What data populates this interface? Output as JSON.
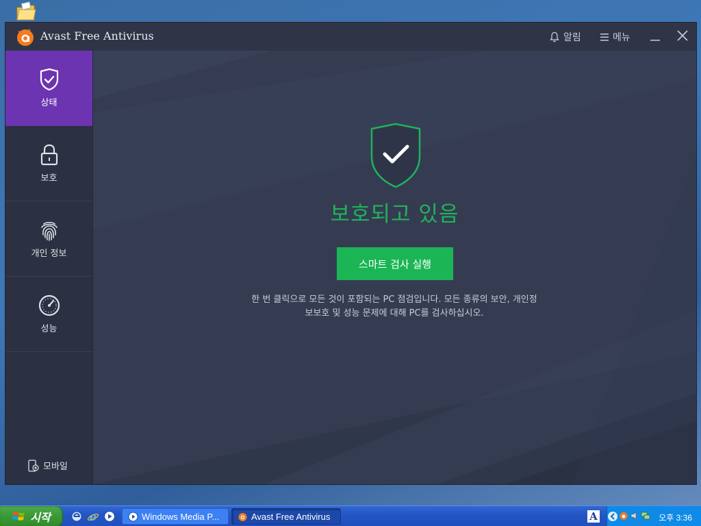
{
  "window": {
    "title": "Avast Free Antivirus",
    "alerts_label": "알림",
    "menu_label": "메뉴"
  },
  "sidebar": {
    "items": [
      {
        "label": "상태",
        "icon": "shield-check-icon",
        "active": true
      },
      {
        "label": "보호",
        "icon": "lock-icon",
        "active": false
      },
      {
        "label": "개인 정보",
        "icon": "fingerprint-icon",
        "active": false
      },
      {
        "label": "성능",
        "icon": "speedometer-icon",
        "active": false
      }
    ],
    "mobile_label": "모바일"
  },
  "main": {
    "status_heading": "보호되고 있음",
    "scan_button_label": "스마트 검사 실행",
    "description_line1": "한 번 클릭으로 모든 것이 포함되는 PC 점검입니다. 모든 종류의 보안, 개인정",
    "description_line2": "보보호 및 성능 문제에 대해 PC를 검사하십시오."
  },
  "taskbar": {
    "start_label": "시작",
    "tasks": [
      {
        "label": "Windows Media P...",
        "icon": "media-player-icon"
      },
      {
        "label": "Avast Free Antivirus",
        "icon": "avast-icon",
        "active": true
      }
    ],
    "language_indicator": "A",
    "clock": "오후 3:36"
  },
  "colors": {
    "accent_purple": "#6d34b1",
    "status_green": "#1fb359",
    "button_green": "#1bb555",
    "avast_orange": "#f47b20",
    "window_bg": "#2f3547"
  }
}
